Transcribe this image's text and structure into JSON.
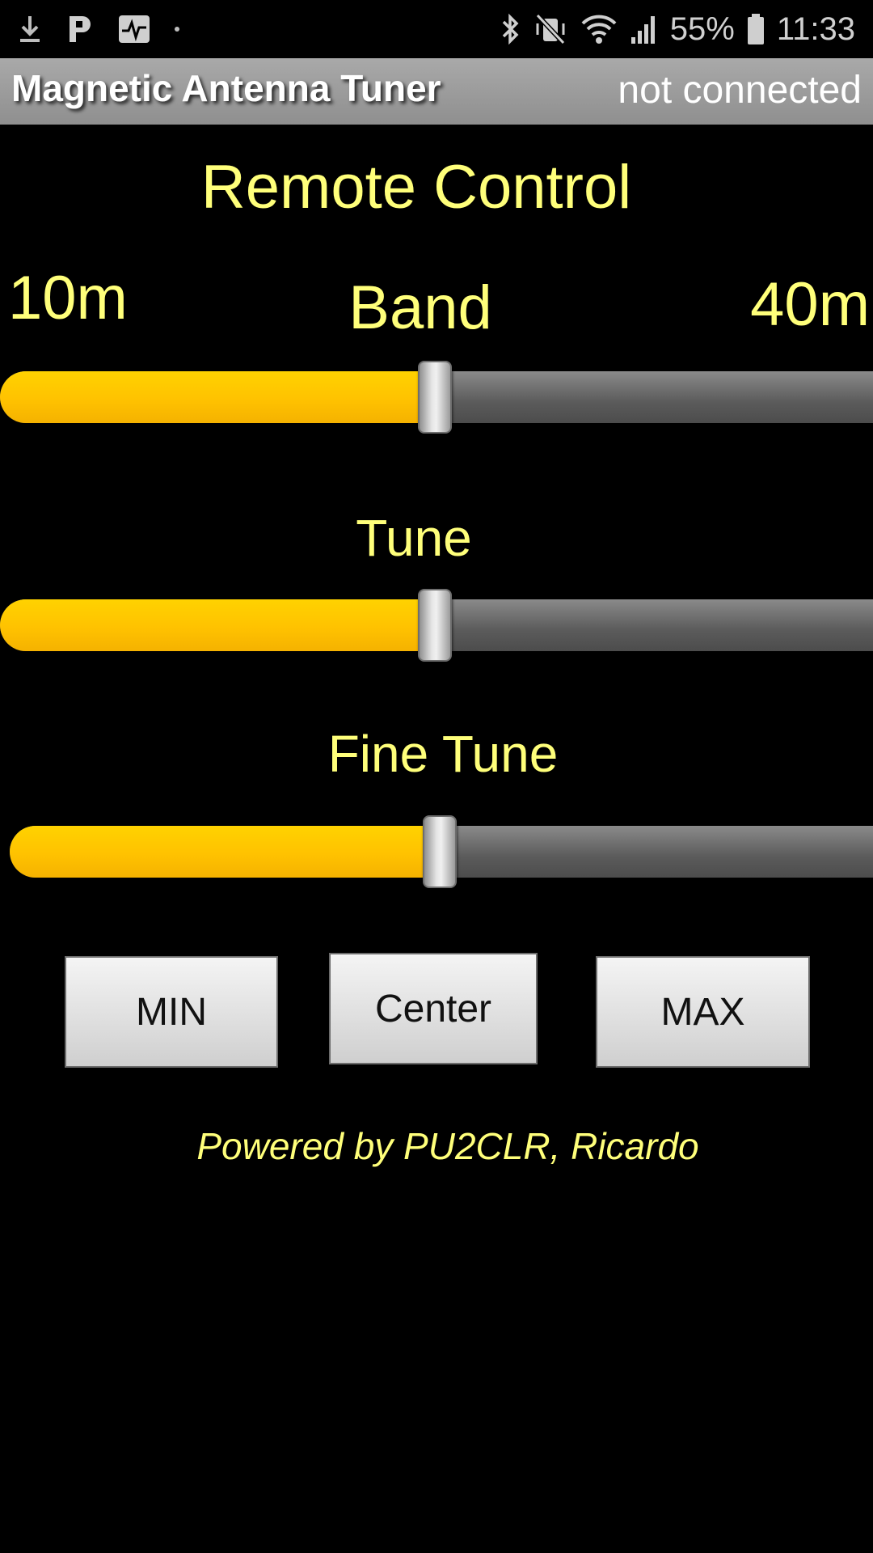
{
  "status_bar": {
    "left_icons": [
      "download-icon",
      "p-app-icon",
      "pulse-app-icon",
      "dot"
    ],
    "right_icons": [
      "bluetooth-icon",
      "vibrate-mute-icon",
      "wifi-icon",
      "signal-icon",
      "battery-icon"
    ],
    "battery_percent": "55%",
    "time": "11:33"
  },
  "app_bar": {
    "title": "Magnetic Antenna Tuner",
    "connection_status": "not connected"
  },
  "main": {
    "section_title": "Remote Control",
    "band": {
      "label": "Band",
      "min_label": "10m",
      "max_label": "40m",
      "value": 0.5
    },
    "tune": {
      "label": "Tune",
      "value": 0.5
    },
    "fine_tune": {
      "label": "Fine Tune",
      "value": 0.5
    },
    "buttons": {
      "min": "MIN",
      "center": "Center",
      "max": "MAX"
    },
    "footer": "Powered by PU2CLR, Ricardo"
  },
  "colors": {
    "accent_yellow": "#ffff7a",
    "slider_fill": "#ffc200",
    "slider_track": "#5b5b5b",
    "app_bar": "#9a9a9a"
  }
}
